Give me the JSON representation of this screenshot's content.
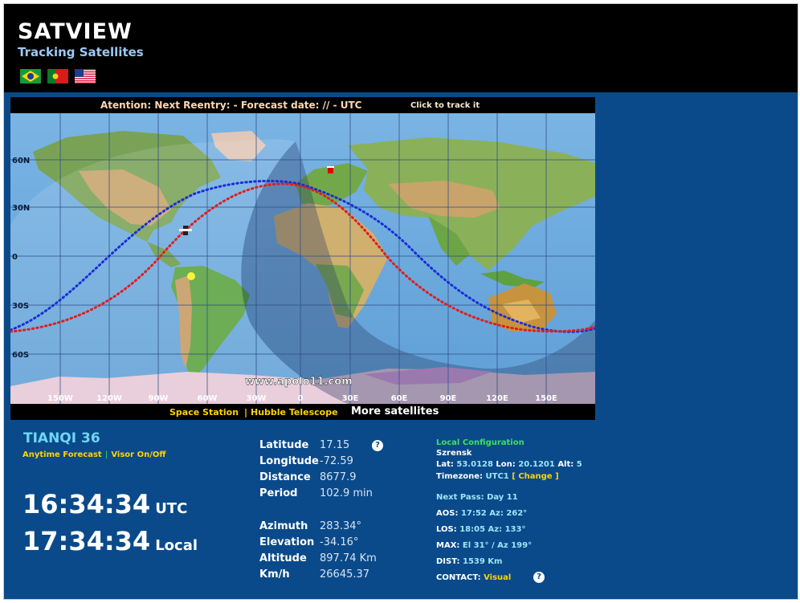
{
  "header": {
    "title": "SATVIEW",
    "subtitle": "Tracking Satellites",
    "flags": [
      "brazil-flag-icon",
      "portugal-flag-icon",
      "usa-flag-icon"
    ]
  },
  "reentry": {
    "text": "Atention: Next Reentry: - Forecast date: // - UTC",
    "link": "Click to track it"
  },
  "map": {
    "watermark": "www.apolo11.com",
    "lat_labels": [
      "60N",
      "30N",
      "0",
      "30S",
      "60S"
    ],
    "lon_labels": [
      "150W",
      "120W",
      "90W",
      "60W",
      "30W",
      "0",
      "30E",
      "60E",
      "90E",
      "120E",
      "150E"
    ]
  },
  "satlinks": {
    "space_station": "Space Station",
    "separator": "|",
    "hubble": "Hubble Telescope",
    "more": "More satellites"
  },
  "satellite": {
    "name": "TIANQI 36",
    "forecast_link": "Anytime Forecast",
    "separator": "|",
    "visor_link": "Visor On/Off"
  },
  "clock": {
    "utc_time": "16:34:34",
    "utc_label": "UTC",
    "local_time": "17:34:34",
    "local_label": "Local"
  },
  "position": {
    "latitude_label": "Latitude",
    "latitude": "17.15",
    "longitude_label": "Longitude",
    "longitude": "-72.59",
    "distance_label": "Distance",
    "distance": "8677.9",
    "period_label": "Period",
    "period": "102.9 min",
    "azimuth_label": "Azimuth",
    "azimuth": "283.34°",
    "elevation_label": "Elevation",
    "elevation": "-34.16°",
    "altitude_label": "Altitude",
    "altitude": "897.74 Km",
    "speed_label": "Km/h",
    "speed": "26645.37"
  },
  "config": {
    "title": "Local Configuration",
    "city": "Szrensk",
    "lat_label": "Lat:",
    "lat": "53.0128",
    "lon_label": "Lon:",
    "lon": "20.1201",
    "alt_label": "Alt:",
    "alt": "5",
    "timezone_label": "Timezone:",
    "timezone": "UTC1",
    "change_link": "[ Change ]",
    "next_pass_label": "Next Pass:",
    "next_pass": "Day 11",
    "aos_label": "AOS:",
    "aos_time": "17:52",
    "aos_az_label": "Az:",
    "aos_az": "262°",
    "los_label": "LOS:",
    "los_time": "18:05",
    "los_az_label": "Az:",
    "los_az": "133°",
    "max_label": "MAX:",
    "max": "El 31° / Az 199°",
    "dist_label": "DIST:",
    "dist": "1539 Km",
    "contact_label": "CONTACT:",
    "contact": "Visual"
  },
  "help_glyph": "?"
}
